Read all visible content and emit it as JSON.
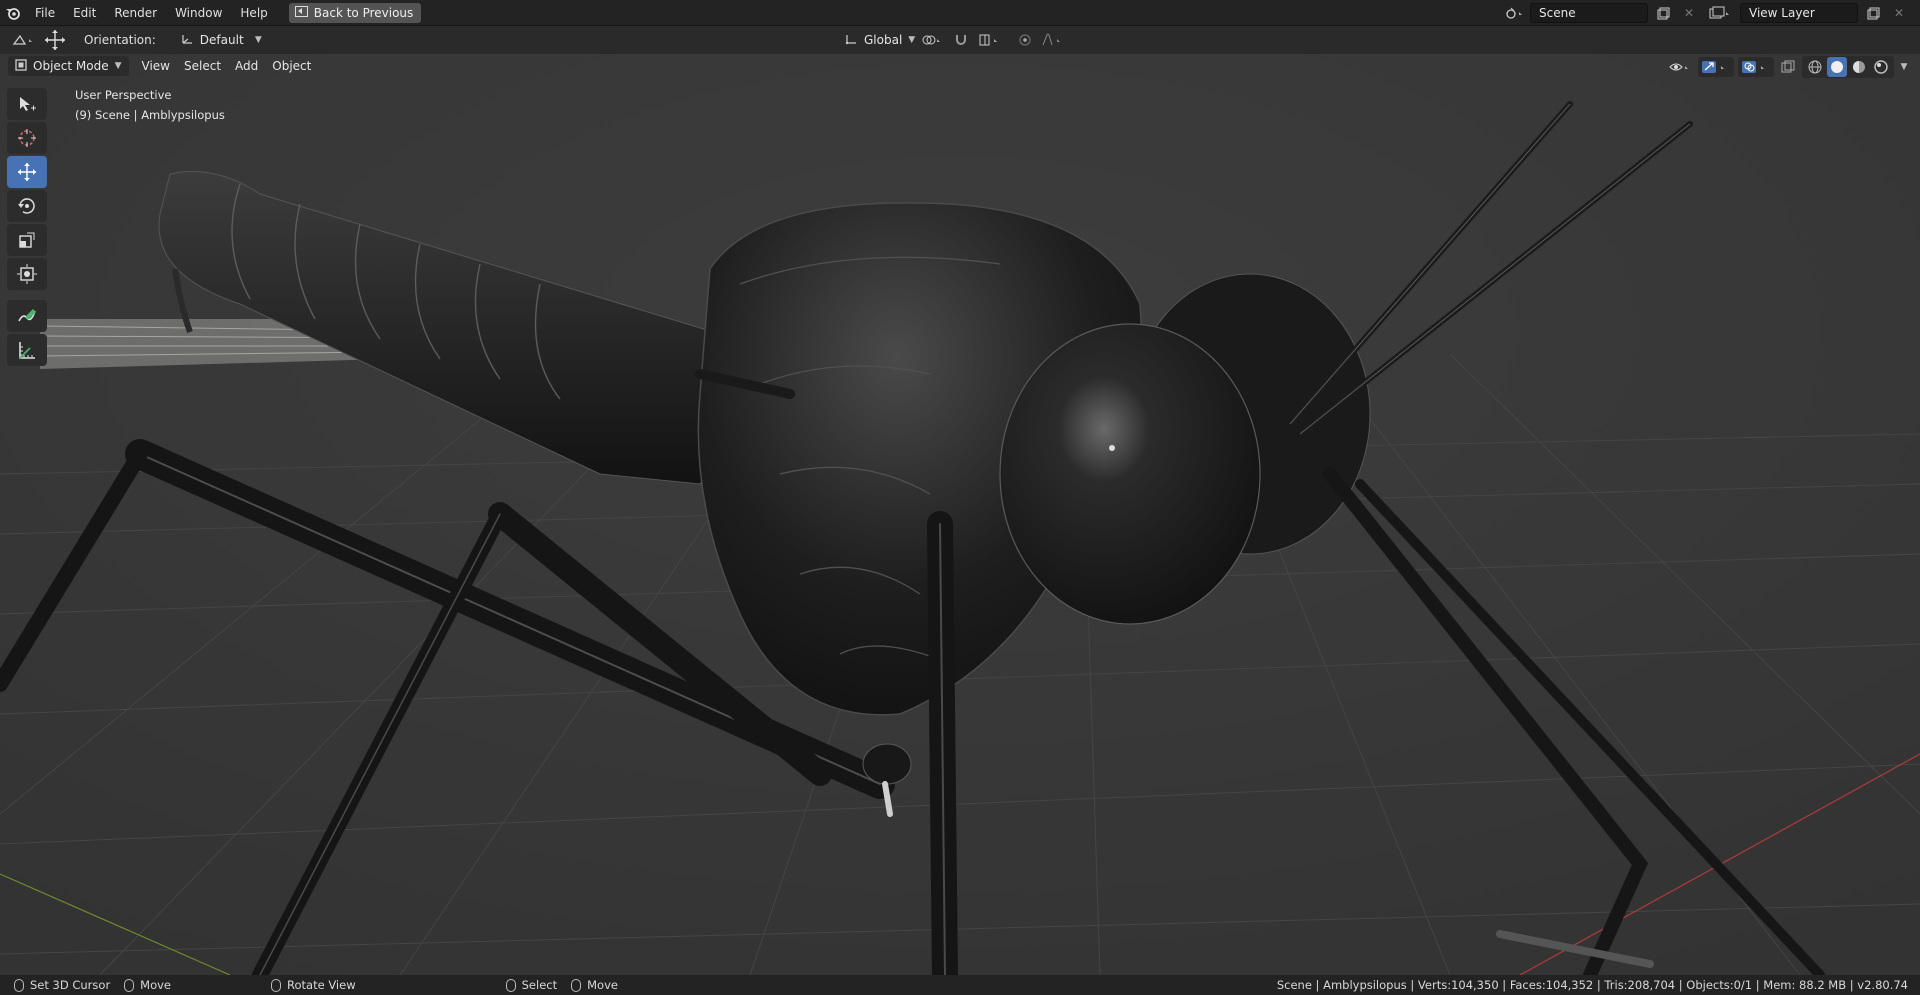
{
  "topbar": {
    "menus": [
      "File",
      "Edit",
      "Render",
      "Window",
      "Help"
    ],
    "back_button": "Back to Previous",
    "scene_field": "Scene",
    "view_layer_field": "View Layer"
  },
  "tool_header": {
    "orientation_label": "Orientation:",
    "orientation_value": "Default",
    "transform_orientation": "Global"
  },
  "viewport_header": {
    "mode": "Object Mode",
    "menus": [
      "View",
      "Select",
      "Add",
      "Object"
    ]
  },
  "viewport": {
    "perspective_label": "User Perspective",
    "scene_label": "(9) Scene | Amblypsilopus"
  },
  "statusbar": {
    "items": [
      {
        "icon": "mouse-left-icon",
        "label": "Set 3D Cursor"
      },
      {
        "icon": "mouse-drag-icon",
        "label": "Move"
      },
      {
        "icon": "mouse-middle-icon",
        "label": "Rotate View"
      },
      {
        "icon": "mouse-left-icon",
        "label": "Select"
      },
      {
        "icon": "mouse-drag-icon",
        "label": "Move"
      }
    ],
    "info": "Scene | Amblypsilopus | Verts:104,350 | Faces:104,352 | Tris:208,704 | Objects:0/1 | Mem: 88.2 MB | v2.80.74"
  },
  "colors": {
    "accent": "#4772b3",
    "background": "#393939",
    "grid": "#444444",
    "x_axis": "#b03a3a",
    "y_axis": "#6e8a2c"
  }
}
